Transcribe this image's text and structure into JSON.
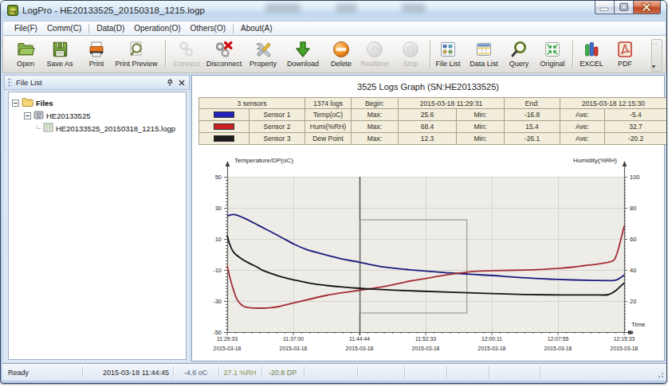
{
  "window": {
    "title": "LogPro - HE20133525_20150318_1215.logp",
    "app_icon": "logpro-app-icon",
    "caption_buttons": {
      "minimize": "minimize",
      "maximize": "maximize",
      "close": "close"
    }
  },
  "menu": {
    "items": [
      {
        "label": "File(F)"
      },
      {
        "label": "Comm(C)"
      },
      {
        "sep": true
      },
      {
        "label": "Data(D)"
      },
      {
        "label": "Operation(O)"
      },
      {
        "label": "Others(O)"
      },
      {
        "sep": true
      },
      {
        "label": "About(A)"
      }
    ]
  },
  "toolbar": {
    "items": [
      {
        "label": "Open",
        "icon": "open-folder-icon",
        "enabled": true,
        "center": 32
      },
      {
        "label": "Save As",
        "icon": "save-as-icon",
        "enabled": true,
        "center": 75
      },
      {
        "label": "Print",
        "icon": "print-icon",
        "enabled": true,
        "center": 121
      },
      {
        "label": "Print Preview",
        "icon": "print-preview-icon",
        "enabled": true,
        "center": 171
      },
      {
        "sep": true,
        "x": 207
      },
      {
        "label": "Connect",
        "icon": "connect-icon",
        "enabled": false,
        "center": 234
      },
      {
        "label": "Disconnect",
        "icon": "disconnect-icon",
        "enabled": true,
        "center": 281
      },
      {
        "label": "Property",
        "icon": "property-icon",
        "enabled": true,
        "center": 330
      },
      {
        "label": "Download",
        "icon": "download-icon",
        "enabled": true,
        "center": 380
      },
      {
        "label": "Delete",
        "icon": "delete-icon",
        "enabled": true,
        "center": 428
      },
      {
        "label": "Realtime",
        "icon": "realtime-icon",
        "enabled": false,
        "center": 470
      },
      {
        "label": "Stop",
        "icon": "stop-icon",
        "enabled": false,
        "center": 515
      },
      {
        "sep": true,
        "x": 539
      },
      {
        "label": "File List",
        "icon": "file-list-icon",
        "enabled": true,
        "center": 562
      },
      {
        "label": "Data List",
        "icon": "data-list-icon",
        "enabled": true,
        "center": 607
      },
      {
        "label": "Query",
        "icon": "query-icon",
        "enabled": true,
        "center": 651
      },
      {
        "label": "Original",
        "icon": "original-icon",
        "enabled": true,
        "center": 693
      },
      {
        "sep": true,
        "x": 718
      },
      {
        "label": "EXCEL",
        "icon": "excel-icon",
        "enabled": true,
        "center": 742
      },
      {
        "label": "PDF",
        "icon": "pdf-icon",
        "enabled": true,
        "center": 784
      }
    ],
    "overflow": {
      "icon": "toolbar-overflow-chevron",
      "dots": "»",
      "arrow": "▾"
    }
  },
  "file_list_panel": {
    "title": "File List",
    "pin_icon": "pin-icon",
    "close_icon": "close-icon",
    "tree": [
      {
        "label": "Files",
        "icon": "folder-icon",
        "bold": true,
        "level": 0,
        "expander": true
      },
      {
        "label": "HE20133525",
        "icon": "device-icon",
        "bold": false,
        "level": 1,
        "expander": true
      },
      {
        "label": "HE20133525_20150318_1215.logp",
        "icon": "logfile-icon",
        "bold": false,
        "level": 2,
        "expander": false
      }
    ]
  },
  "graph": {
    "title": "3525 Logs Graph (SN:HE20133525)",
    "summary_table": {
      "header_row": {
        "sensors": "3 sensors",
        "logs": "1374 logs",
        "begin_label": "Begin:",
        "begin": "2015-03-18 11:29:31",
        "end_label": "End:",
        "end": "2015-03-18 12:15:30"
      },
      "rows": [
        {
          "color": "#2222bb",
          "name": "Sensor 1",
          "type": "Temp(oC)",
          "max_label": "Max:",
          "max": "25.6",
          "min_label": "Min:",
          "min": "-16.8",
          "ave_label": "Ave:",
          "ave": "-5.4"
        },
        {
          "color": "#cc2222",
          "name": "Sensor 2",
          "type": "Humi(%RH)",
          "max_label": "Max:",
          "max": "68.4",
          "min_label": "Min:",
          "min": "15.4",
          "ave_label": "Ave:",
          "ave": "32.7"
        },
        {
          "color": "#1c1c1c",
          "name": "Sensor 3",
          "type": "Dew Point",
          "max_label": "Max:",
          "max": "12.3",
          "min_label": "Min:",
          "min": "-26.1",
          "ave_label": "Ave:",
          "ave": "-20.2"
        }
      ]
    }
  },
  "chart_data": {
    "type": "line",
    "left_axis": {
      "label": "Temperature/DP(oC)",
      "min": -50,
      "max": 50,
      "ticks": [
        50,
        30,
        10,
        -10,
        -30,
        -50
      ]
    },
    "right_axis": {
      "label": "Humidity(%RH)",
      "min": 0,
      "max": 100,
      "ticks": [
        100,
        80,
        60,
        40,
        20,
        0
      ]
    },
    "x_axis": {
      "label": "Time",
      "ticks": [
        "11:29:33",
        "11:37:00",
        "11:44:44",
        "11:52:33",
        "12:00:11",
        "12:07:55",
        "12:15:33"
      ],
      "dates": [
        "2015-03-18",
        "2015-03-18",
        "2015-03-18",
        "2015-03-18",
        "2015-03-18",
        "2015-03-18",
        "2015-03-18"
      ]
    },
    "grid": true,
    "cursor": {
      "x_frac": 0.3333
    },
    "selection_rect": {
      "x1_frac": 0.335,
      "x2_frac": 0.604,
      "v1_left": 22.3,
      "v2_left": -37.7
    },
    "series": [
      {
        "name": "Temp(oC)",
        "axis": "left",
        "color": "#1b1b7e",
        "points": [
          [
            0,
            24.8
          ],
          [
            0.02,
            25.6
          ],
          [
            0.05,
            22.5
          ],
          [
            0.08,
            18.5
          ],
          [
            0.11,
            14.6
          ],
          [
            0.14,
            10.5
          ],
          [
            0.17,
            6.4
          ],
          [
            0.2,
            3.2
          ],
          [
            0.23,
            0.9
          ],
          [
            0.26,
            -1.1
          ],
          [
            0.29,
            -3.0
          ],
          [
            0.333,
            -5.0
          ],
          [
            0.37,
            -7.0
          ],
          [
            0.4,
            -8.3
          ],
          [
            0.46,
            -9.9
          ],
          [
            0.51,
            -10.9
          ],
          [
            0.56,
            -11.9
          ],
          [
            0.62,
            -12.9
          ],
          [
            0.67,
            -13.6
          ],
          [
            0.71,
            -14.4
          ],
          [
            0.75,
            -15.1
          ],
          [
            0.81,
            -15.9
          ],
          [
            0.87,
            -16.4
          ],
          [
            0.92,
            -16.7
          ],
          [
            0.96,
            -16.8
          ],
          [
            0.98,
            -16.5
          ],
          [
            1,
            -13.4
          ]
        ]
      },
      {
        "name": "Humi(%RH)",
        "axis": "right",
        "color": "#a32e35",
        "points": [
          [
            0,
            42.5
          ],
          [
            0.008,
            34
          ],
          [
            0.016,
            27
          ],
          [
            0.025,
            21
          ],
          [
            0.04,
            16.8
          ],
          [
            0.06,
            15.6
          ],
          [
            0.09,
            15.4
          ],
          [
            0.11,
            15.7
          ],
          [
            0.13,
            16.4
          ],
          [
            0.17,
            18.9
          ],
          [
            0.21,
            21.3
          ],
          [
            0.25,
            23.6
          ],
          [
            0.29,
            25.3
          ],
          [
            0.333,
            26.9
          ],
          [
            0.37,
            28.3
          ],
          [
            0.4,
            29.6
          ],
          [
            0.46,
            32.8
          ],
          [
            0.51,
            35.0
          ],
          [
            0.56,
            37.1
          ],
          [
            0.59,
            38.1
          ],
          [
            0.63,
            39.2
          ],
          [
            0.67,
            39.6
          ],
          [
            0.75,
            39.9
          ],
          [
            0.79,
            40.3
          ],
          [
            0.83,
            41.0
          ],
          [
            0.87,
            41.8
          ],
          [
            0.9,
            42.8
          ],
          [
            0.93,
            43.7
          ],
          [
            0.96,
            45.0
          ],
          [
            0.975,
            46.5
          ],
          [
            0.985,
            53
          ],
          [
            1,
            68.4
          ]
        ]
      },
      {
        "name": "Dew Point",
        "axis": "left",
        "color": "#141414",
        "points": [
          [
            0,
            12.3
          ],
          [
            0.005,
            7.5
          ],
          [
            0.016,
            1.5
          ],
          [
            0.036,
            -2.8
          ],
          [
            0.056,
            -5.7
          ],
          [
            0.075,
            -8.1
          ],
          [
            0.09,
            -10.3
          ],
          [
            0.13,
            -13.9
          ],
          [
            0.17,
            -16.5
          ],
          [
            0.21,
            -18.6
          ],
          [
            0.25,
            -20.0
          ],
          [
            0.29,
            -21.0
          ],
          [
            0.333,
            -21.8
          ],
          [
            0.37,
            -22.4
          ],
          [
            0.42,
            -23.0
          ],
          [
            0.48,
            -23.6
          ],
          [
            0.56,
            -24.3
          ],
          [
            0.65,
            -25.1
          ],
          [
            0.75,
            -25.8
          ],
          [
            0.84,
            -26.1
          ],
          [
            0.93,
            -26.1
          ],
          [
            0.96,
            -25.9
          ],
          [
            0.98,
            -23.0
          ],
          [
            1,
            -18.4
          ]
        ]
      }
    ]
  },
  "status_bar": {
    "cells": [
      {
        "text": "Ready",
        "color": "#1b1b1b",
        "x1": 2,
        "x2": 100,
        "align": "left"
      },
      {
        "text": "2015-03-18 11:44:45",
        "color": "#1b1b1b",
        "x1": 100,
        "x2": 214,
        "align": "right"
      },
      {
        "text": "-4.6 oC",
        "color": "#53627a",
        "x1": 214,
        "x2": 271,
        "align": "center"
      },
      {
        "text": "27.1 %RH",
        "color": "#87954d",
        "x1": 271,
        "x2": 325,
        "align": "center"
      },
      {
        "text": "-20.8 DP",
        "color": "#6f7c46",
        "x1": 325,
        "x2": 378,
        "align": "center"
      },
      {
        "text": "",
        "color": "#1b1b1b",
        "x1": 378,
        "x2": 445,
        "align": "left"
      },
      {
        "text": "",
        "color": "#1b1b1b",
        "x1": 445,
        "x2": 504,
        "align": "left"
      },
      {
        "text": "",
        "color": "#1b1b1b",
        "x1": 504,
        "x2": 557,
        "align": "left"
      },
      {
        "text": "",
        "color": "#1b1b1b",
        "x1": 557,
        "x2": 610,
        "align": "left"
      },
      {
        "text": "",
        "color": "#1b1b1b",
        "x1": 610,
        "x2": 674,
        "align": "left"
      },
      {
        "text": "",
        "color": "#1b1b1b",
        "x1": 674,
        "x2": 829,
        "align": "left"
      }
    ]
  },
  "title_blur_patches": [
    {
      "x": 332,
      "w": 44
    },
    {
      "x": 420,
      "w": 27
    },
    {
      "x": 503,
      "w": 30
    }
  ]
}
